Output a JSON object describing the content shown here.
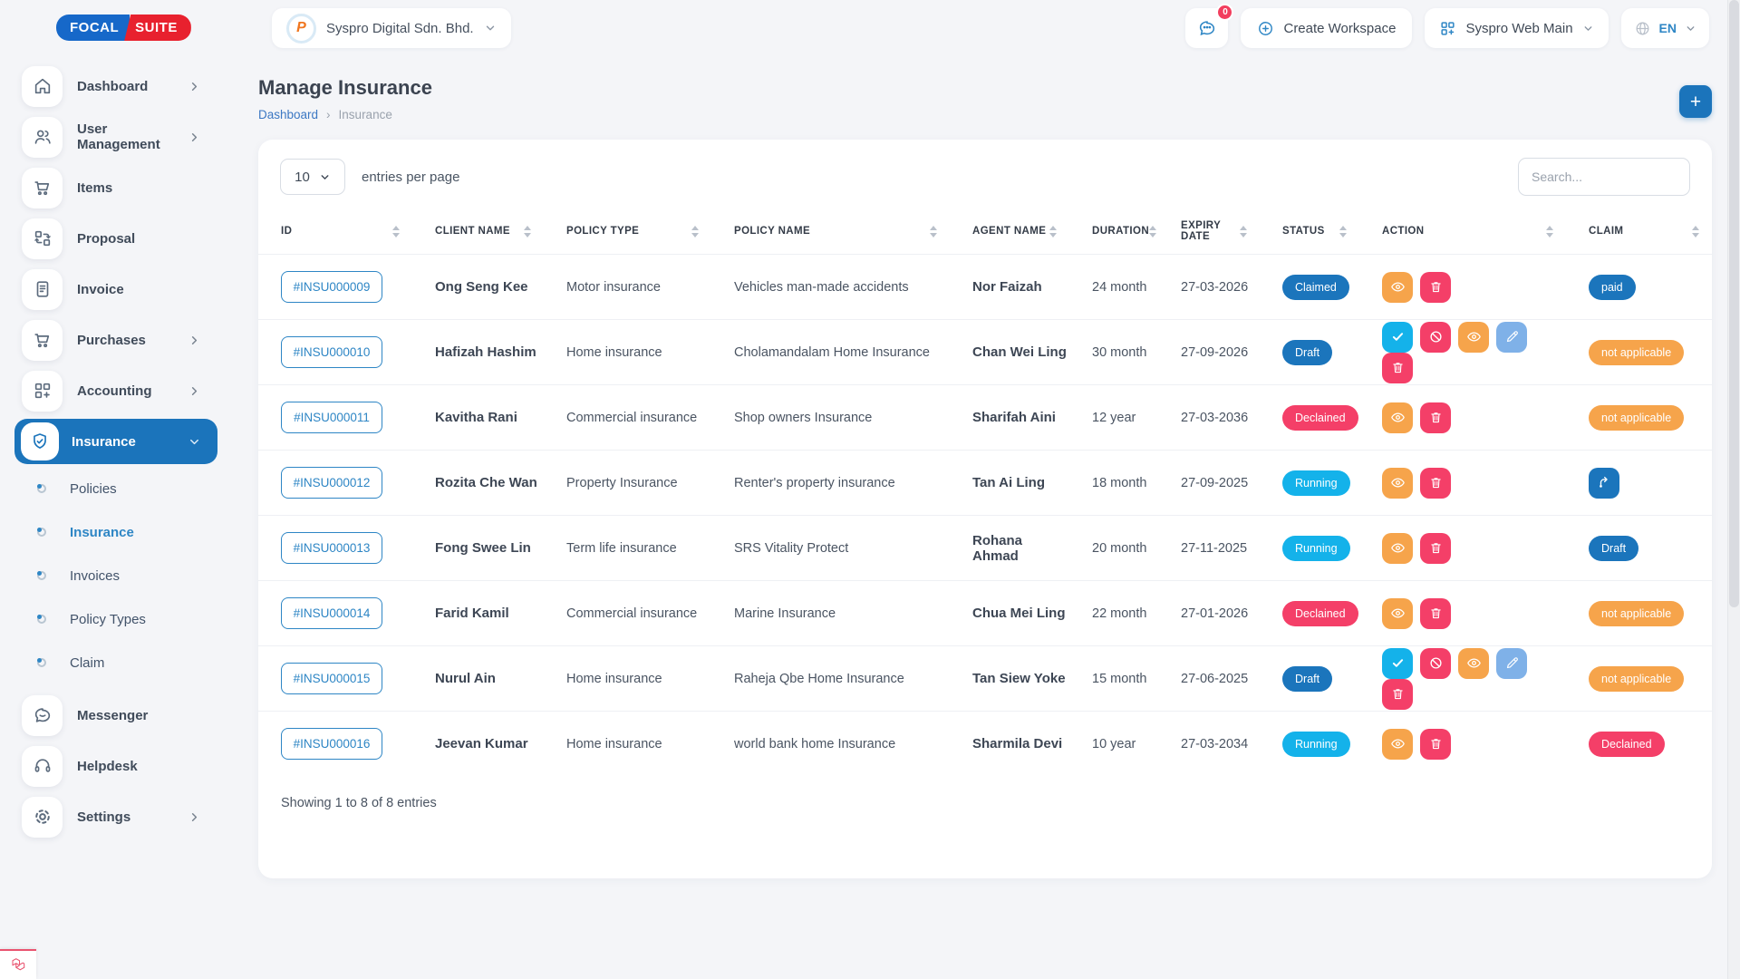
{
  "colors": {
    "primary_blue": "#1b75bc",
    "cyan": "#14b2ea",
    "pink": "#f43f68",
    "orange": "#f6a44b",
    "light_blue": "#7fb1e8",
    "brand_blue": "#1668c9",
    "brand_red": "#e8212e"
  },
  "brand": {
    "left": "FOCAL",
    "right": "SUITE"
  },
  "topbar": {
    "company_name": "Syspro Digital Sdn. Bhd.",
    "chat_badge_count": "0",
    "create_workspace_label": "Create Workspace",
    "workspace_name": "Syspro Web Main",
    "language_code": "EN"
  },
  "sidebar": {
    "main_items": [
      {
        "label": "Dashboard",
        "icon": "home",
        "chevron": "right",
        "active": false
      },
      {
        "label": "User Management",
        "icon": "users",
        "chevron": "right",
        "active": false
      },
      {
        "label": "Items",
        "icon": "cart",
        "chevron": "",
        "active": false
      },
      {
        "label": "Proposal",
        "icon": "proposal",
        "chevron": "",
        "active": false
      },
      {
        "label": "Invoice",
        "icon": "invoice",
        "chevron": "",
        "active": false
      },
      {
        "label": "Purchases",
        "icon": "cart",
        "chevron": "right",
        "active": false
      },
      {
        "label": "Accounting",
        "icon": "gridplus",
        "chevron": "right",
        "active": false
      },
      {
        "label": "Insurance",
        "icon": "shield",
        "chevron": "down",
        "active": true
      }
    ],
    "sub_items": [
      {
        "label": "Policies",
        "active": false
      },
      {
        "label": "Insurance",
        "active": true
      },
      {
        "label": "Invoices",
        "active": false
      },
      {
        "label": "Policy Types",
        "active": false
      },
      {
        "label": "Claim",
        "active": false
      }
    ],
    "bottom_items": [
      {
        "label": "Messenger",
        "icon": "chat",
        "chevron": ""
      },
      {
        "label": "Helpdesk",
        "icon": "headset",
        "chevron": ""
      },
      {
        "label": "Settings",
        "icon": "gear",
        "chevron": "right"
      }
    ]
  },
  "page": {
    "title": "Manage Insurance",
    "breadcrumb_root": "Dashboard",
    "breadcrumb_separator": "›",
    "breadcrumb_current": "Insurance",
    "add_button_label": "+"
  },
  "controls": {
    "entries_per_page_value": "10",
    "entries_per_page_label": "entries per page",
    "search_placeholder": "Search..."
  },
  "table": {
    "columns": [
      "ID",
      "CLIENT NAME",
      "POLICY TYPE",
      "POLICY NAME",
      "AGENT NAME",
      "DURATION",
      "EXPIRY DATE",
      "STATUS",
      "ACTION",
      "CLAIM"
    ],
    "rows": [
      {
        "id": "#INSU000009",
        "client_name": "Ong Seng Kee",
        "policy_type": "Motor insurance",
        "policy_name": "Vehicles man-made accidents",
        "agent_name": "Nor Faizah",
        "duration": "24 month",
        "expiry_date": "27-03-2026",
        "status": {
          "label": "Claimed",
          "color": "blue"
        },
        "actions": [
          "view",
          "delete"
        ],
        "claim": {
          "type": "badge",
          "label": "paid",
          "color": "blue"
        }
      },
      {
        "id": "#INSU000010",
        "client_name": "Hafizah Hashim",
        "policy_type": "Home insurance",
        "policy_name": "Cholamandalam Home Insurance",
        "agent_name": "Chan Wei Ling",
        "duration": "30 month",
        "expiry_date": "27-09-2026",
        "status": {
          "label": "Draft",
          "color": "blue"
        },
        "actions": [
          "approve",
          "ban",
          "view",
          "edit",
          "delete"
        ],
        "claim": {
          "type": "badge",
          "label": "not applicable",
          "color": "orange"
        }
      },
      {
        "id": "#INSU000011",
        "client_name": "Kavitha Rani",
        "policy_type": "Commercial insurance",
        "policy_name": "Shop owners Insurance",
        "agent_name": "Sharifah Aini",
        "duration": "12 year",
        "expiry_date": "27-03-2036",
        "status": {
          "label": "Declained",
          "color": "pink"
        },
        "actions": [
          "view",
          "delete"
        ],
        "claim": {
          "type": "badge",
          "label": "not applicable",
          "color": "orange"
        }
      },
      {
        "id": "#INSU000012",
        "client_name": "Rozita Che Wan",
        "policy_type": "Property Insurance",
        "policy_name": "Renter's property insurance",
        "agent_name": "Tan Ai Ling",
        "duration": "18 month",
        "expiry_date": "27-09-2025",
        "status": {
          "label": "Running",
          "color": "cyan"
        },
        "actions": [
          "view",
          "delete"
        ],
        "claim": {
          "type": "button",
          "icon": "route-icon"
        }
      },
      {
        "id": "#INSU000013",
        "client_name": "Fong Swee Lin",
        "policy_type": "Term life insurance",
        "policy_name": "SRS Vitality Protect",
        "agent_name": "Rohana Ahmad",
        "duration": "20 month",
        "expiry_date": "27-11-2025",
        "status": {
          "label": "Running",
          "color": "cyan"
        },
        "actions": [
          "view",
          "delete"
        ],
        "claim": {
          "type": "badge",
          "label": "Draft",
          "color": "blue"
        }
      },
      {
        "id": "#INSU000014",
        "client_name": "Farid Kamil",
        "policy_type": "Commercial insurance",
        "policy_name": "Marine Insurance",
        "agent_name": "Chua Mei Ling",
        "duration": "22 month",
        "expiry_date": "27-01-2026",
        "status": {
          "label": "Declained",
          "color": "pink"
        },
        "actions": [
          "view",
          "delete"
        ],
        "claim": {
          "type": "badge",
          "label": "not applicable",
          "color": "orange"
        }
      },
      {
        "id": "#INSU000015",
        "client_name": "Nurul Ain",
        "policy_type": "Home insurance",
        "policy_name": "Raheja Qbe Home Insurance",
        "agent_name": "Tan Siew Yoke",
        "duration": "15 month",
        "expiry_date": "27-06-2025",
        "status": {
          "label": "Draft",
          "color": "blue"
        },
        "actions": [
          "approve",
          "ban",
          "view",
          "edit",
          "delete"
        ],
        "claim": {
          "type": "badge",
          "label": "not applicable",
          "color": "orange"
        }
      },
      {
        "id": "#INSU000016",
        "client_name": "Jeevan Kumar",
        "policy_type": "Home insurance",
        "policy_name": "world bank home Insurance",
        "agent_name": "Sharmila Devi",
        "duration": "10 year",
        "expiry_date": "27-03-2034",
        "status": {
          "label": "Running",
          "color": "cyan"
        },
        "actions": [
          "view",
          "delete"
        ],
        "claim": {
          "type": "badge",
          "label": "Declained",
          "color": "pink"
        }
      }
    ],
    "footer_text": "Showing 1 to 8 of 8 entries"
  }
}
